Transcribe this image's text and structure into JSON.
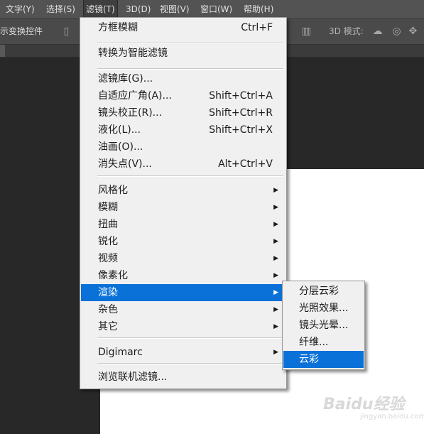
{
  "menubar": {
    "items": [
      "文字(Y)",
      "选择(S)",
      "滤镜(T)",
      "3D(D)",
      "视图(V)",
      "窗口(W)",
      "帮助(H)"
    ],
    "active_index": 2
  },
  "options_bar": {
    "left_text": "示变换控件",
    "mode_label": "3D 模式:"
  },
  "filter_menu": {
    "last_filter": {
      "label": "方框模糊",
      "shortcut": "Ctrl+F"
    },
    "smart": "转换为智能滤镜",
    "group1": [
      {
        "label": "滤镜库(G)...",
        "shortcut": ""
      },
      {
        "label": "自适应广角(A)...",
        "shortcut": "Shift+Ctrl+A"
      },
      {
        "label": "镜头校正(R)...",
        "shortcut": "Shift+Ctrl+R"
      },
      {
        "label": "液化(L)...",
        "shortcut": "Shift+Ctrl+X"
      },
      {
        "label": "油画(O)...",
        "shortcut": ""
      },
      {
        "label": "消失点(V)...",
        "shortcut": "Alt+Ctrl+V"
      }
    ],
    "group2": [
      "风格化",
      "模糊",
      "扭曲",
      "锐化",
      "视频",
      "像素化",
      "渲染",
      "杂色",
      "其它"
    ],
    "highlighted": "渲染",
    "digimarc": "Digimarc",
    "browse": "浏览联机滤镜..."
  },
  "render_submenu": {
    "items": [
      "分层云彩",
      "光照效果...",
      "镜头光晕...",
      "纤维...",
      "云彩"
    ],
    "highlighted": "云彩"
  },
  "watermark": {
    "logo": "Baidu经验",
    "sub": "jingyan.baidu.com"
  },
  "colors": {
    "highlight": "#0a71d8",
    "menu_bg": "#f0f0f0",
    "menubar_bg": "#535353",
    "workspace": "#282828"
  }
}
